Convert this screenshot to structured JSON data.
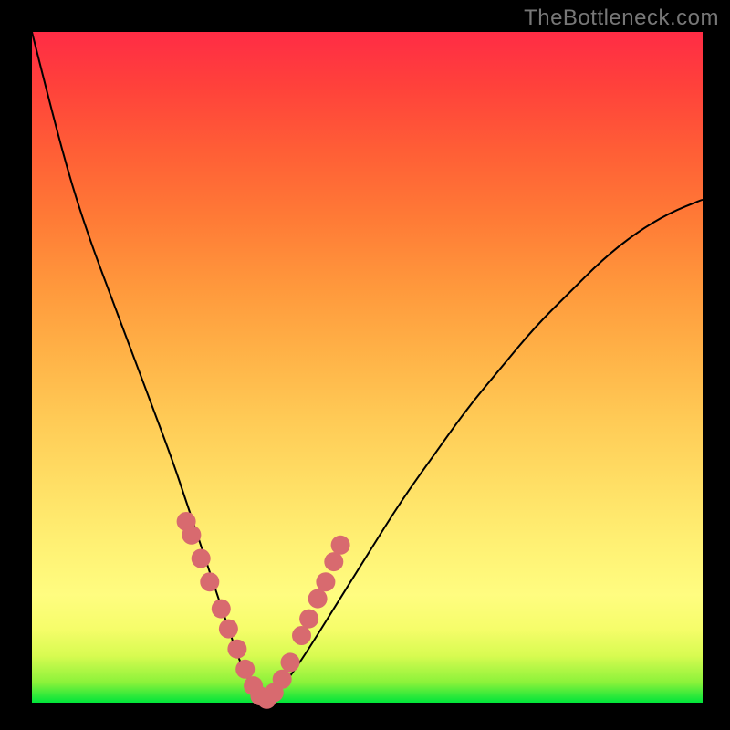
{
  "watermark": "TheBottleneck.com",
  "colors": {
    "background": "#000000",
    "dot": "#d86a6f",
    "curve": "#000000"
  },
  "chart_data": {
    "type": "line",
    "title": "",
    "xlabel": "",
    "ylabel": "",
    "xlim": [
      0,
      100
    ],
    "ylim": [
      0,
      100
    ],
    "grid": false,
    "legend": false,
    "series": [
      {
        "name": "bottleneck-curve",
        "x": [
          0,
          3,
          6,
          9,
          12,
          15,
          18,
          21,
          23,
          25,
          27,
          29,
          31,
          33,
          35,
          37,
          40,
          45,
          50,
          55,
          60,
          65,
          70,
          75,
          80,
          85,
          90,
          95,
          100
        ],
        "y": [
          100,
          88,
          77,
          68,
          60,
          52,
          44,
          36,
          30,
          24,
          18,
          12,
          6,
          2,
          0,
          2,
          6,
          14,
          22,
          30,
          37,
          44,
          50,
          56,
          61,
          66,
          70,
          73,
          75
        ]
      }
    ],
    "markers": {
      "name": "highlight-dots",
      "x": [
        23,
        23.8,
        25.2,
        26.5,
        28.2,
        29.3,
        30.6,
        31.8,
        33.0,
        34.0,
        35.0,
        36.1,
        37.3,
        38.5,
        40.2,
        41.3,
        42.6,
        43.8,
        45.0,
        46.0
      ],
      "y": [
        27,
        25,
        21.5,
        18,
        14,
        11,
        8,
        5,
        2.5,
        1,
        0.5,
        1.5,
        3.5,
        6,
        10,
        12.5,
        15.5,
        18,
        21,
        23.5
      ]
    },
    "gradient_stops": [
      {
        "pos": 0.0,
        "color": "#00e53a"
      },
      {
        "pos": 0.1,
        "color": "#d8fb51"
      },
      {
        "pos": 0.2,
        "color": "#fffd80"
      },
      {
        "pos": 0.4,
        "color": "#ffcb56"
      },
      {
        "pos": 0.6,
        "color": "#ff983c"
      },
      {
        "pos": 0.8,
        "color": "#ff5f36"
      },
      {
        "pos": 1.0,
        "color": "#ff2c45"
      }
    ]
  }
}
